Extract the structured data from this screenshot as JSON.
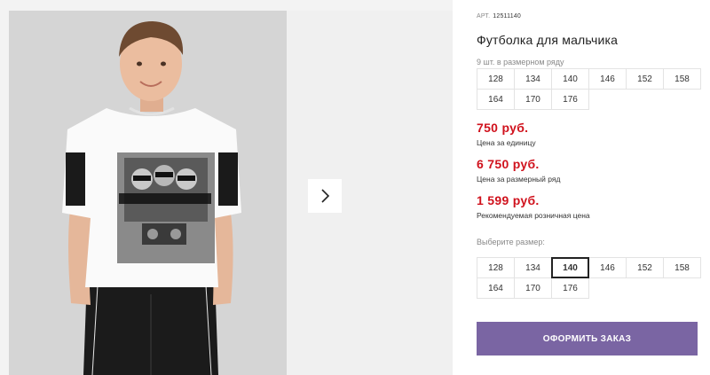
{
  "product": {
    "art_label": "АРТ.",
    "art_number": "12511140",
    "title": "Футболка для мальчика"
  },
  "pack": {
    "label": "9 шт. в размерном ряду",
    "sizes": [
      "128",
      "134",
      "140",
      "146",
      "152",
      "158",
      "164",
      "170",
      "176"
    ]
  },
  "prices": [
    {
      "value": "750 руб.",
      "note": "Цена за единицу"
    },
    {
      "value": "6 750 руб.",
      "note": "Цена за размерный ряд"
    },
    {
      "value": "1 599 руб.",
      "note": "Рекомендуемая розничная цена"
    }
  ],
  "size_picker": {
    "label": "Выберите размер:",
    "sizes": [
      "128",
      "134",
      "140",
      "146",
      "152",
      "158",
      "164",
      "170",
      "176"
    ],
    "selected": "140"
  },
  "order_button": {
    "label": "ОФОРМИТЬ ЗАКАЗ"
  },
  "gallery": {
    "next_icon": "chevron-right-icon"
  },
  "colors": {
    "price": "#d0121d",
    "accent": "#7a65a3"
  }
}
